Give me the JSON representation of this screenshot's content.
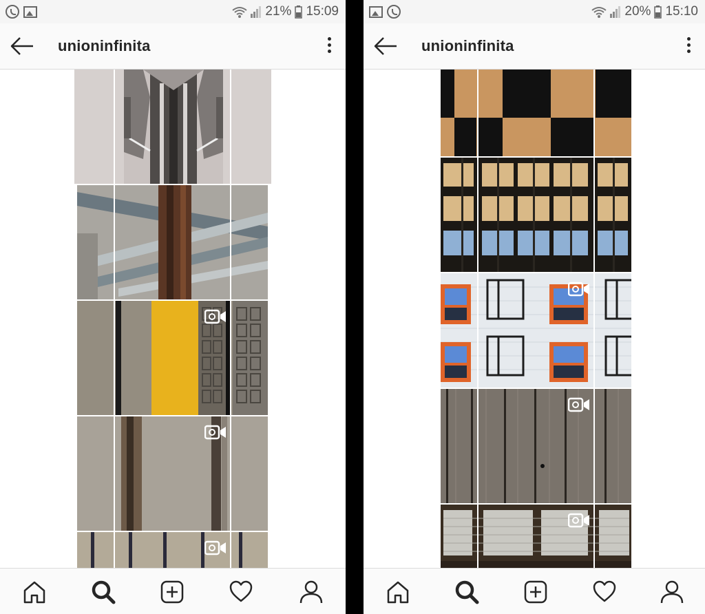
{
  "screens": [
    {
      "status": {
        "battery": "21%",
        "time": "15:09"
      },
      "appbar": {
        "title": "unioninfinita"
      },
      "bottom_nav": [
        "home-icon",
        "search-icon",
        "add-post-icon",
        "heart-icon",
        "profile-icon"
      ]
    },
    {
      "status": {
        "battery": "20%",
        "time": "15:10"
      },
      "appbar": {
        "title": "unioninfinita"
      },
      "bottom_nav": [
        "home-icon",
        "search-icon",
        "add-post-icon",
        "heart-icon",
        "profile-icon"
      ]
    }
  ],
  "colors": {
    "accent_yellow": "#e8b21d",
    "window_orange": "#e0642a",
    "wood_tan": "#c99660",
    "icon_dark": "#262626"
  }
}
